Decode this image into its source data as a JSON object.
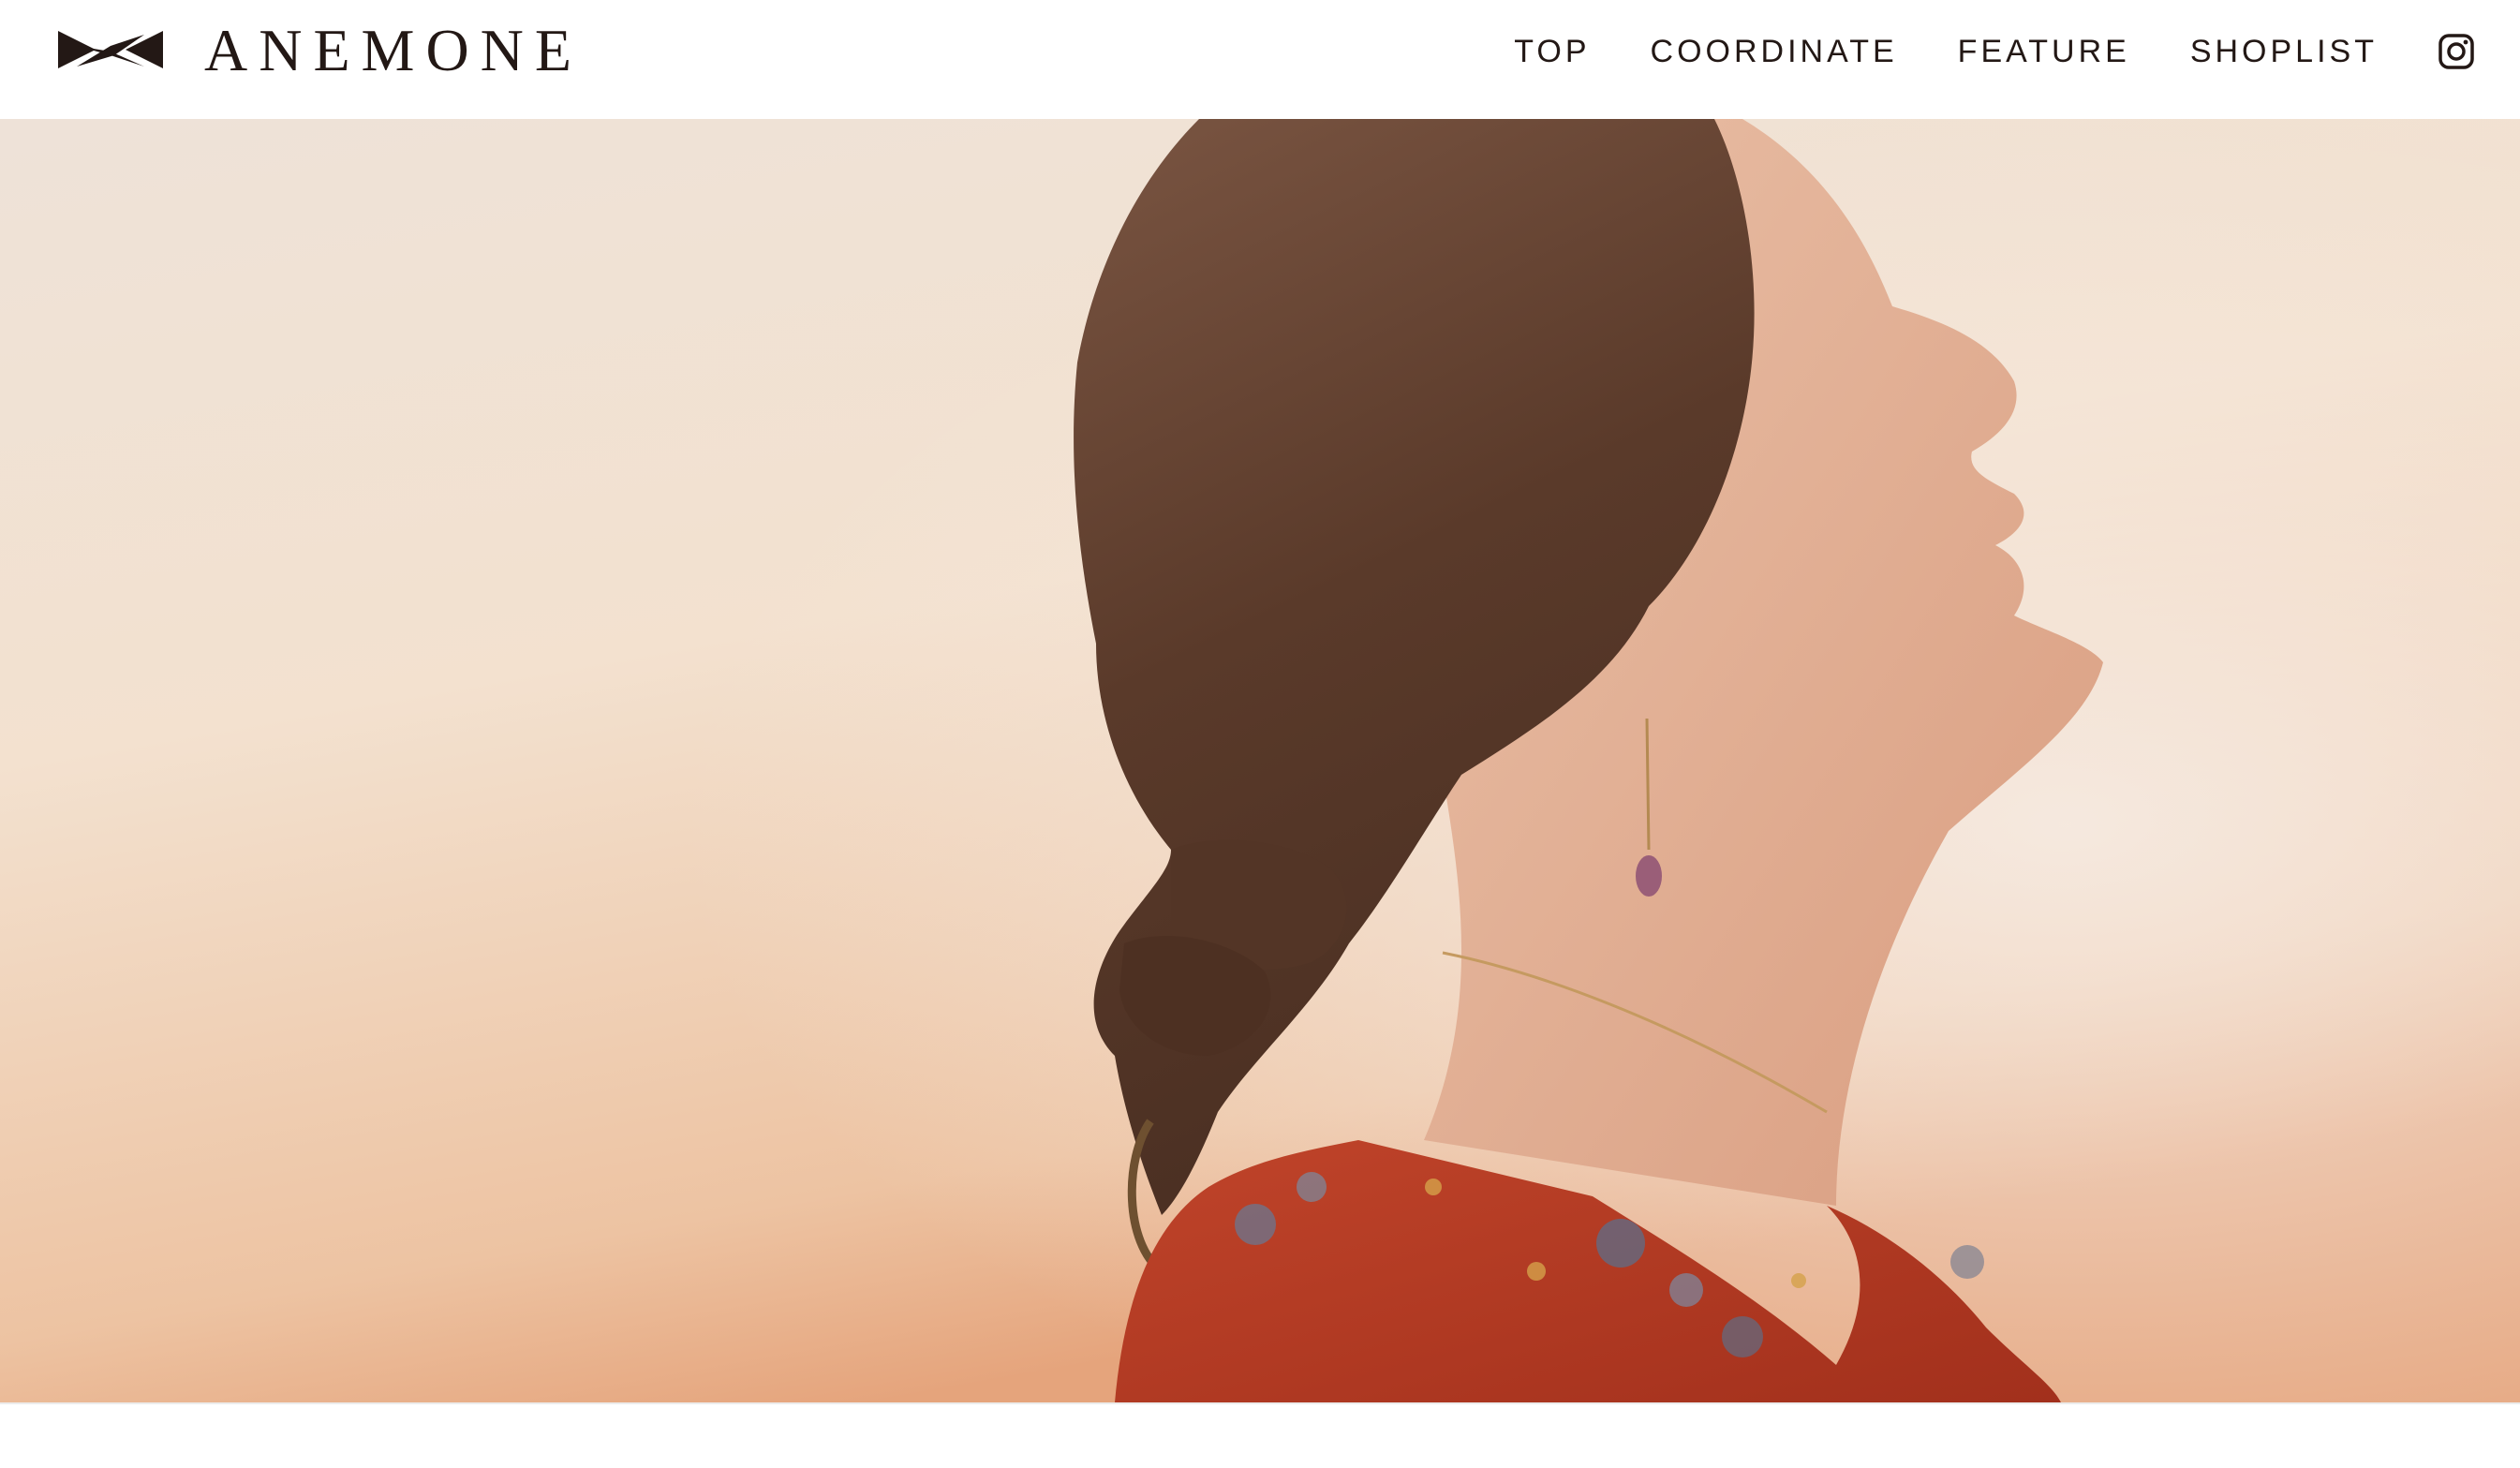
{
  "header": {
    "brand_name": "ANEMONE",
    "logo_icon": "bowtie-logo-icon",
    "nav": [
      {
        "label": "TOP"
      },
      {
        "label": "COORDINATE"
      },
      {
        "label": "FEATURE"
      },
      {
        "label": "SHOPLIST"
      }
    ],
    "social_icon": "instagram-icon"
  },
  "hero": {
    "image": "woman-profile-red-floral-blouse-hero-photo"
  },
  "colors": {
    "ink": "#231815",
    "background": "#ffffff",
    "sky_light": "#f3e6da",
    "sky_warm": "#e9b792",
    "hair": "#5e3d2d",
    "blouse": "#b13a22"
  }
}
